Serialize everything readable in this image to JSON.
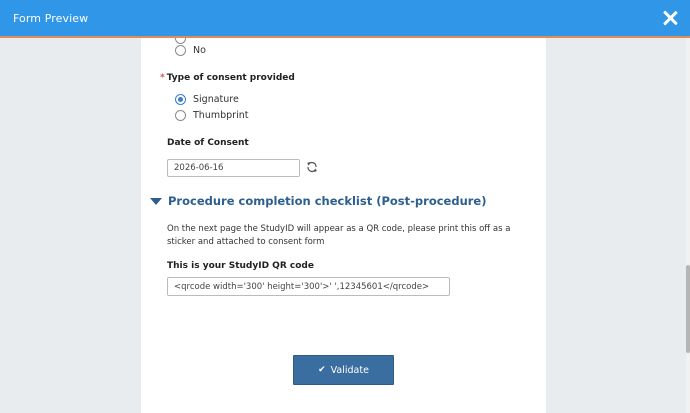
{
  "window": {
    "title": "Form Preview"
  },
  "form": {
    "prev_options": {
      "no_label": "No"
    },
    "consent_type": {
      "label": "Type of consent provided",
      "required_marker": "*",
      "options": [
        "Signature",
        "Thumbprint"
      ],
      "selected": "Signature"
    },
    "date_of_consent": {
      "label": "Date of Consent",
      "value": "2026-06-16"
    },
    "section": {
      "title": "Procedure completion checklist (Post-procedure)",
      "info": "On the next page the StudyID will appear as a QR code, please print this off as a sticker and attached to consent form"
    },
    "qr": {
      "label": "This is your StudyID QR code",
      "value": "<qrcode width='300' height='300'>' ',12345601</qrcode>"
    },
    "validate_label": "Validate"
  },
  "colors": {
    "titlebar": "#2f96e8",
    "accent": "#e28a5b",
    "section_heading": "#2c5f8f",
    "button": "#3b6ea0"
  }
}
